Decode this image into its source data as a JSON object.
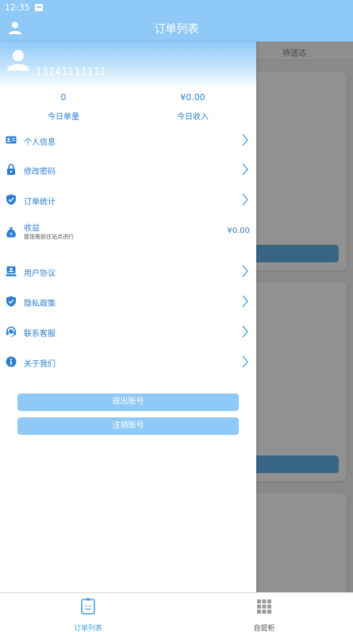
{
  "status_bar": {
    "time": "12:35"
  },
  "header": {
    "title": "订单列表"
  },
  "background": {
    "tab_label": "待送达"
  },
  "drawer": {
    "phone": "13241111111",
    "stats": [
      {
        "value": "0",
        "label": "今日单量"
      },
      {
        "value": "¥0.00",
        "label": "今日收入"
      }
    ],
    "menu": [
      {
        "label": "个人信息",
        "icon": "id-card-icon"
      },
      {
        "label": "修改密码",
        "icon": "lock-icon"
      },
      {
        "label": "订单统计",
        "icon": "shield-check-icon"
      },
      {
        "label": "收益",
        "sub": "提现需前往站点进行",
        "value": "¥0.00",
        "icon": "money-bag-icon"
      },
      {
        "label": "用户协议",
        "icon": "user-card-icon"
      },
      {
        "label": "隐私政策",
        "icon": "shield-check-icon"
      },
      {
        "label": "联系客服",
        "icon": "headset-icon"
      },
      {
        "label": "关于我们",
        "icon": "info-icon"
      }
    ],
    "logout_label": "退出账号",
    "delete_label": "注销账号"
  },
  "bottom_nav": [
    {
      "label": "订单列表",
      "icon": "order-list-icon",
      "active": true
    },
    {
      "label": "自提柜",
      "icon": "locker-grid-icon",
      "active": false
    }
  ],
  "colors": {
    "primary": "#8fc9f7",
    "accent_text": "#2c7fd0",
    "active_tab": "#4aa3e6"
  }
}
